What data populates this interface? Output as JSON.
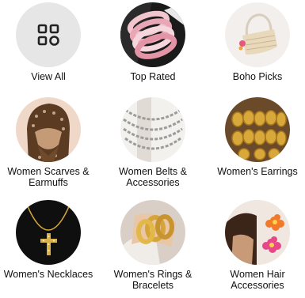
{
  "categories": [
    {
      "label": "View All",
      "icon": "grid-icon"
    },
    {
      "label": "Top Rated",
      "icon": "bracelet-stack-icon"
    },
    {
      "label": "Boho Picks",
      "icon": "handbag-icon"
    },
    {
      "label": "Women Scarves & Earmuffs",
      "icon": "head-scarf-icon"
    },
    {
      "label": "Women Belts & Accessories",
      "icon": "chain-necklace-icon"
    },
    {
      "label": "Women's Earrings",
      "icon": "hoop-earrings-icon"
    },
    {
      "label": "Women's Necklaces",
      "icon": "cross-necklace-icon"
    },
    {
      "label": "Women's Rings & Bracelets",
      "icon": "gold-bracelets-icon"
    },
    {
      "label": "Women Hair Accessories",
      "icon": "hair-flowers-icon"
    }
  ]
}
